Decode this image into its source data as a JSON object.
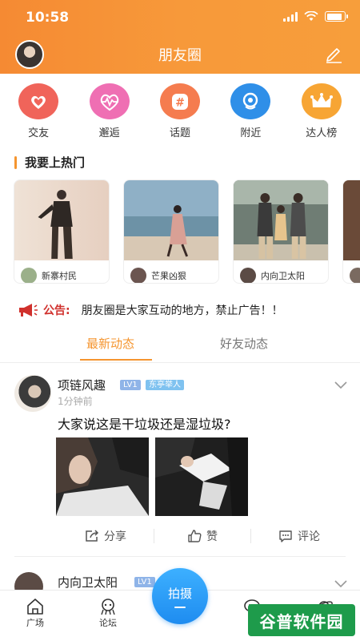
{
  "status": {
    "time": "10:58"
  },
  "header": {
    "title": "朋友圈"
  },
  "categories": [
    {
      "label": "交友",
      "icon": "heart-icon",
      "color": "#f0645a"
    },
    {
      "label": "邂逅",
      "icon": "pulse-heart-icon",
      "color": "#ef6fb3"
    },
    {
      "label": "话题",
      "icon": "hashtag-icon",
      "color": "#f57c4f"
    },
    {
      "label": "附近",
      "icon": "location-icon",
      "color": "#2f8fe8"
    },
    {
      "label": "达人榜",
      "icon": "crown-icon",
      "color": "#f7a534"
    }
  ],
  "hot": {
    "title": "我要上热门",
    "cards": [
      {
        "user": "新寨村民"
      },
      {
        "user": "芒果凶狠"
      },
      {
        "user": "内向卫太阳"
      },
      {
        "user": ""
      }
    ]
  },
  "notice": {
    "label": "公告:",
    "text": "朋友圈是大家互动的地方，禁止广告！！"
  },
  "tabs": {
    "latest": "最新动态",
    "friends": "好友动态"
  },
  "post": {
    "name": "项链风趣",
    "level": "LV1",
    "tag": "东亭举人",
    "time": "1分钟前",
    "content": "大家说这是干垃圾还是湿垃圾?",
    "actions": {
      "share": "分享",
      "like": "赞",
      "comment": "评论"
    }
  },
  "post2": {
    "name": "内向卫太阳",
    "level": "LV1"
  },
  "bottom_nav": {
    "plaza": "广场",
    "forum": "论坛",
    "shoot": "拍摄"
  },
  "watermark": "谷普软件园",
  "colors": {
    "brand_orange": "#f5952f",
    "fab_blue": "#1e8cf0",
    "notice_red": "#d0312d"
  }
}
